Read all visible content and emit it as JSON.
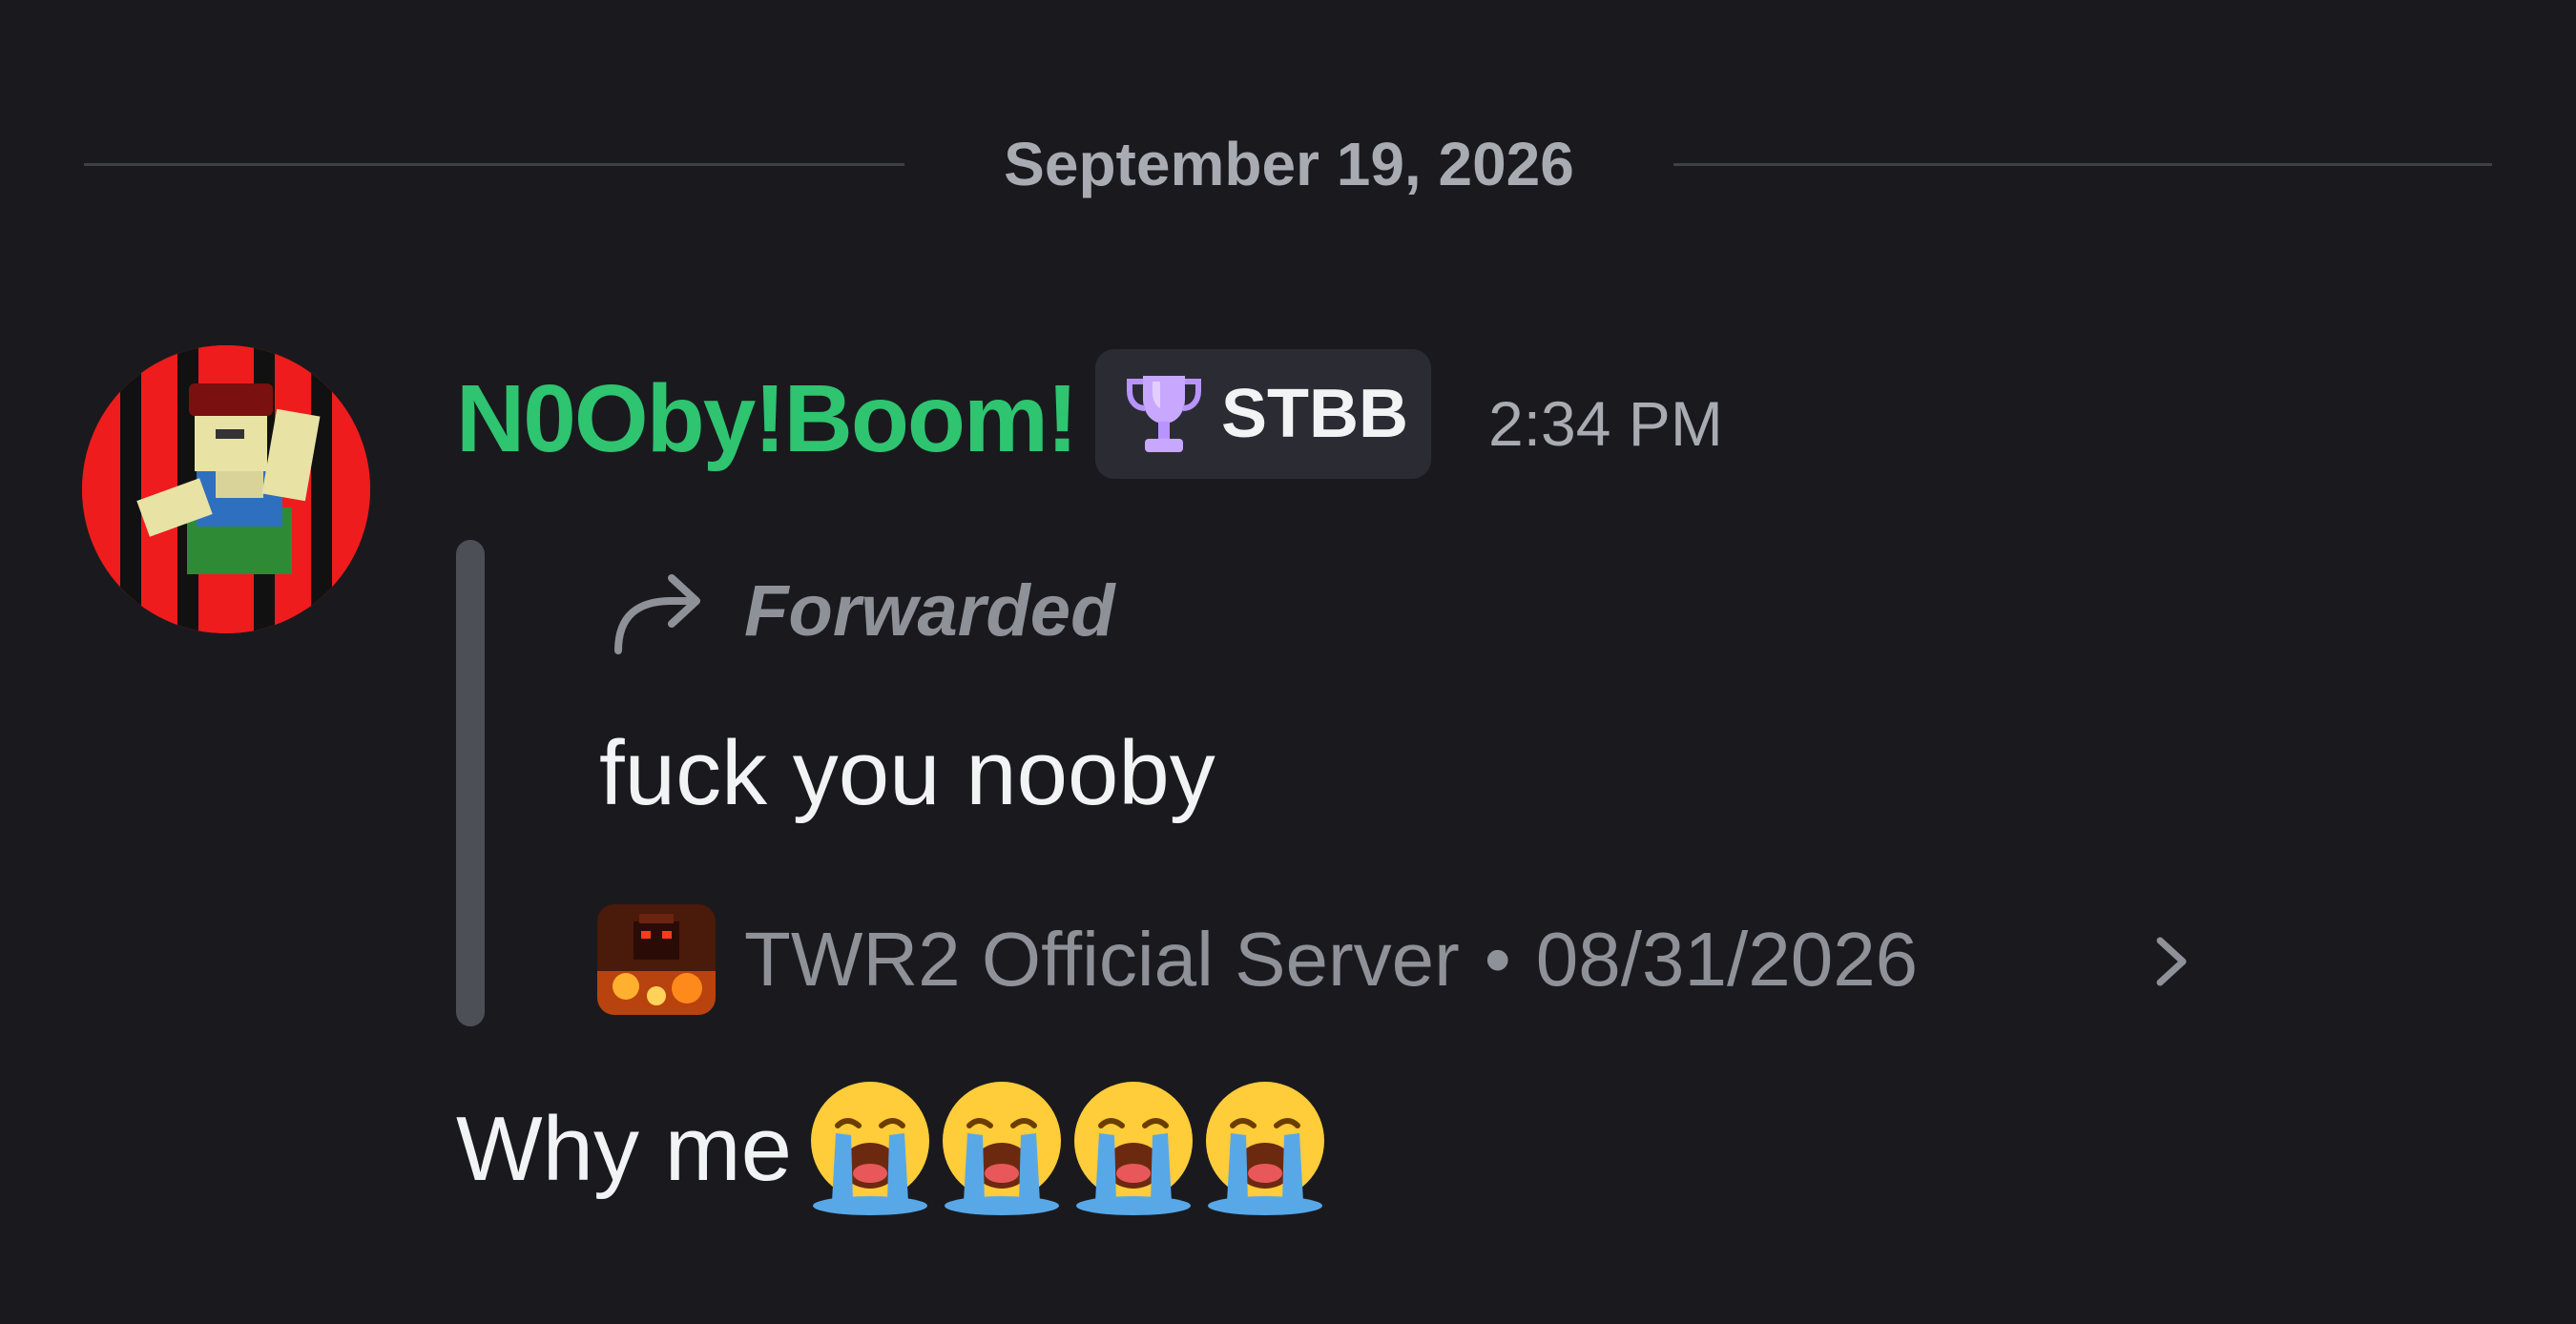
{
  "date_divider": "September 19, 2026",
  "message": {
    "username": "N0Oby!Boom!",
    "username_color": "#2ec470",
    "role_tag": {
      "icon": "trophy-icon",
      "label": "STBB"
    },
    "timestamp": "2:34 PM",
    "forward": {
      "icon": "forward-arrow-icon",
      "label": "Forwarded",
      "text": "fuck you nooby",
      "server_name": "TWR2 Official Server",
      "separator": "•",
      "date": "08/31/2026",
      "chevron_icon": "chevron-right-icon"
    },
    "text": "Why me",
    "emojis": [
      "loudly-crying-face",
      "loudly-crying-face",
      "loudly-crying-face",
      "loudly-crying-face"
    ]
  },
  "colors": {
    "background": "#1a1a1e",
    "muted_text": "#a9abb3",
    "quote_bar": "#4d4f57",
    "role_tag_bg": "#2b2c33"
  }
}
